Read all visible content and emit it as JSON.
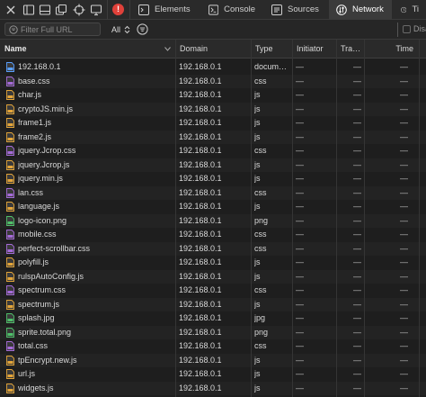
{
  "toolbar": {
    "error_count": "!",
    "tabs": [
      {
        "label": "Elements",
        "icon": "elements-icon",
        "active": false
      },
      {
        "label": "Console",
        "icon": "console-icon",
        "active": false
      },
      {
        "label": "Sources",
        "icon": "sources-icon",
        "active": false
      },
      {
        "label": "Network",
        "icon": "network-icon",
        "active": true
      },
      {
        "label": "Ti",
        "icon": "timelines-icon",
        "active": false
      }
    ]
  },
  "filter_bar": {
    "filter_placeholder": "Filter Full URL",
    "type_filter": "All",
    "disable_cache_label": "Disa"
  },
  "columns": {
    "name": "Name",
    "domain": "Domain",
    "type": "Type",
    "initiator": "Initiator",
    "transfer": "Tra…",
    "time": "Time"
  },
  "requests": [
    {
      "name": "192.168.0.1",
      "domain": "192.168.0.1",
      "type": "docum…",
      "initiator": "—",
      "transfer": "—",
      "time": "—",
      "kind": "doc"
    },
    {
      "name": "base.css",
      "domain": "192.168.0.1",
      "type": "css",
      "initiator": "—",
      "transfer": "—",
      "time": "—",
      "kind": "css"
    },
    {
      "name": "char.js",
      "domain": "192.168.0.1",
      "type": "js",
      "initiator": "—",
      "transfer": "—",
      "time": "—",
      "kind": "js"
    },
    {
      "name": "cryptoJS.min.js",
      "domain": "192.168.0.1",
      "type": "js",
      "initiator": "—",
      "transfer": "—",
      "time": "—",
      "kind": "js"
    },
    {
      "name": "frame1.js",
      "domain": "192.168.0.1",
      "type": "js",
      "initiator": "—",
      "transfer": "—",
      "time": "—",
      "kind": "js"
    },
    {
      "name": "frame2.js",
      "domain": "192.168.0.1",
      "type": "js",
      "initiator": "—",
      "transfer": "—",
      "time": "—",
      "kind": "js"
    },
    {
      "name": "jquery.Jcrop.css",
      "domain": "192.168.0.1",
      "type": "css",
      "initiator": "—",
      "transfer": "—",
      "time": "—",
      "kind": "css"
    },
    {
      "name": "jquery.Jcrop.js",
      "domain": "192.168.0.1",
      "type": "js",
      "initiator": "—",
      "transfer": "—",
      "time": "—",
      "kind": "js"
    },
    {
      "name": "jquery.min.js",
      "domain": "192.168.0.1",
      "type": "js",
      "initiator": "—",
      "transfer": "—",
      "time": "—",
      "kind": "js"
    },
    {
      "name": "lan.css",
      "domain": "192.168.0.1",
      "type": "css",
      "initiator": "—",
      "transfer": "—",
      "time": "—",
      "kind": "css"
    },
    {
      "name": "language.js",
      "domain": "192.168.0.1",
      "type": "js",
      "initiator": "—",
      "transfer": "—",
      "time": "—",
      "kind": "js"
    },
    {
      "name": "logo-icon.png",
      "domain": "192.168.0.1",
      "type": "png",
      "initiator": "—",
      "transfer": "—",
      "time": "—",
      "kind": "img"
    },
    {
      "name": "mobile.css",
      "domain": "192.168.0.1",
      "type": "css",
      "initiator": "—",
      "transfer": "—",
      "time": "—",
      "kind": "css"
    },
    {
      "name": "perfect-scrollbar.css",
      "domain": "192.168.0.1",
      "type": "css",
      "initiator": "—",
      "transfer": "—",
      "time": "—",
      "kind": "css"
    },
    {
      "name": "polyfill.js",
      "domain": "192.168.0.1",
      "type": "js",
      "initiator": "—",
      "transfer": "—",
      "time": "—",
      "kind": "js"
    },
    {
      "name": "rulspAutoConfig.js",
      "domain": "192.168.0.1",
      "type": "js",
      "initiator": "—",
      "transfer": "—",
      "time": "—",
      "kind": "js"
    },
    {
      "name": "spectrum.css",
      "domain": "192.168.0.1",
      "type": "css",
      "initiator": "—",
      "transfer": "—",
      "time": "—",
      "kind": "css"
    },
    {
      "name": "spectrum.js",
      "domain": "192.168.0.1",
      "type": "js",
      "initiator": "—",
      "transfer": "—",
      "time": "—",
      "kind": "js"
    },
    {
      "name": "splash.jpg",
      "domain": "192.168.0.1",
      "type": "jpg",
      "initiator": "—",
      "transfer": "—",
      "time": "—",
      "kind": "img"
    },
    {
      "name": "sprite.total.png",
      "domain": "192.168.0.1",
      "type": "png",
      "initiator": "—",
      "transfer": "—",
      "time": "—",
      "kind": "img"
    },
    {
      "name": "total.css",
      "domain": "192.168.0.1",
      "type": "css",
      "initiator": "—",
      "transfer": "—",
      "time": "—",
      "kind": "css"
    },
    {
      "name": "tpEncrypt.new.js",
      "domain": "192.168.0.1",
      "type": "js",
      "initiator": "—",
      "transfer": "—",
      "time": "—",
      "kind": "js"
    },
    {
      "name": "url.js",
      "domain": "192.168.0.1",
      "type": "js",
      "initiator": "—",
      "transfer": "—",
      "time": "—",
      "kind": "js"
    },
    {
      "name": "widgets.js",
      "domain": "192.168.0.1",
      "type": "js",
      "initiator": "—",
      "transfer": "—",
      "time": "—",
      "kind": "js"
    }
  ],
  "colors": {
    "error_badge": "#e0413a",
    "file_doc": "#5aa0ff",
    "file_css": "#a56bd8",
    "file_js": "#e3a53a",
    "file_img": "#4fbf6a"
  }
}
